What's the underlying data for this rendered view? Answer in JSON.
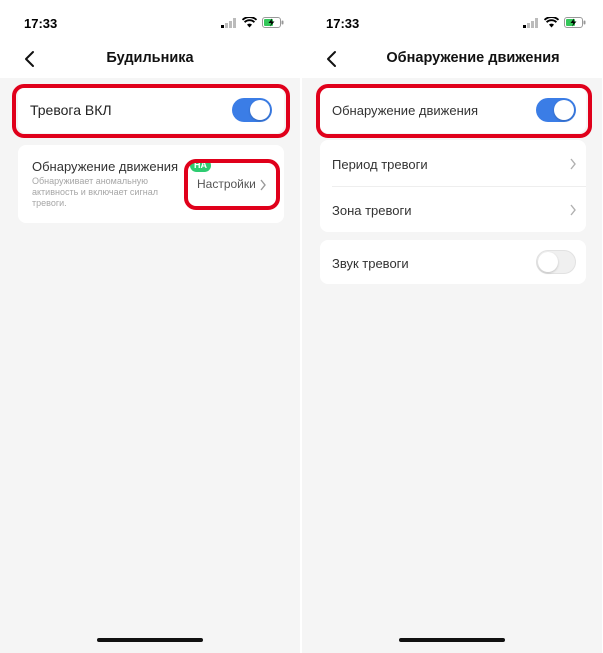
{
  "colors": {
    "accent": "#3b7de6",
    "highlight": "#e0001b",
    "badge": "#2ecc71"
  },
  "left": {
    "status": {
      "time": "17:33"
    },
    "header": {
      "title": "Будильника"
    },
    "alarm": {
      "label": "Тревога ВКЛ",
      "enabled": true
    },
    "motion": {
      "title": "Обнаружение движения",
      "badge": "НА",
      "description_lines": [
        "Обнаруживает аномальную",
        "активность и включает сигнал",
        "тревоги."
      ],
      "settings_label": "Настройки"
    }
  },
  "right": {
    "status": {
      "time": "17:33"
    },
    "header": {
      "title": "Обнаружение движения"
    },
    "motion_toggle": {
      "label": "Обнаружение движения",
      "enabled": true
    },
    "items": [
      {
        "label": "Период тревоги"
      },
      {
        "label": "Зона тревоги"
      }
    ],
    "sound": {
      "label": "Звук тревоги",
      "enabled": false
    }
  }
}
